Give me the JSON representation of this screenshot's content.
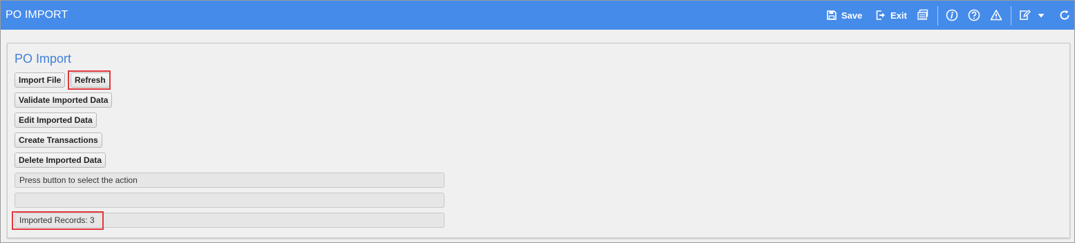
{
  "header": {
    "title": "PO IMPORT",
    "save_label": "Save",
    "exit_label": "Exit",
    "accent_color": "#458bea"
  },
  "toolbar_icons": [
    "save-icon",
    "exit-icon",
    "print-icon",
    "info-icon",
    "help-icon",
    "warning-icon",
    "edit-icon",
    "dropdown-caret-icon",
    "refresh-icon"
  ],
  "panel": {
    "title": "PO Import",
    "title_color": "#3f7fd6",
    "buttons": {
      "import_file": "Import File",
      "refresh": "Refresh",
      "validate": "Validate Imported Data",
      "edit": "Edit Imported Data",
      "create": "Create Transactions",
      "delete": "Delete Imported Data"
    },
    "status_message": "Press button to select the action",
    "status_message_2": "",
    "imported_records": "Imported Records:  3"
  },
  "highlight_color": "#e0383e"
}
